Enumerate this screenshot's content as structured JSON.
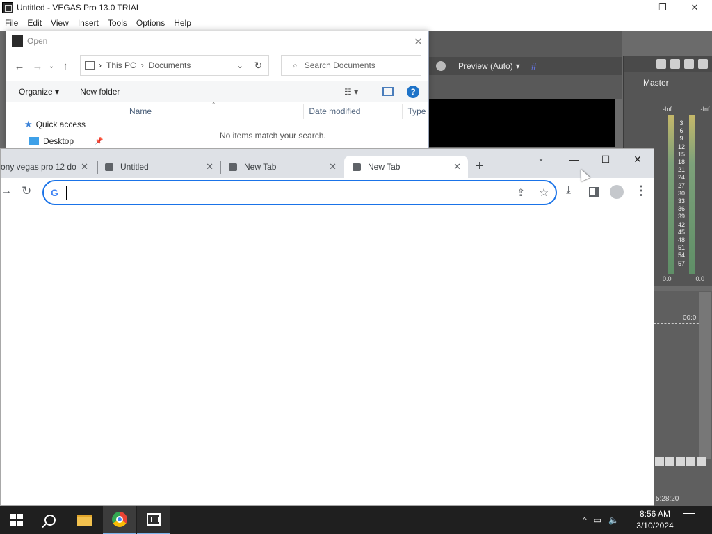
{
  "vegas": {
    "title": "Untitled - VEGAS Pro 13.0 TRIAL",
    "window_controls": {
      "minimize": "—",
      "maximize": "❐",
      "close": "✕"
    },
    "menu": [
      "File",
      "Edit",
      "View",
      "Insert",
      "Tools",
      "Options",
      "Help"
    ],
    "preview_mode": "Preview (Auto)",
    "master_label": "Master",
    "meter_inf_left": "-Inf.",
    "meter_inf_right": "-Inf.",
    "meter_scale": [
      "3",
      "6",
      "9",
      "12",
      "15",
      "18",
      "21",
      "24",
      "27",
      "30",
      "33",
      "36",
      "39",
      "42",
      "45",
      "48",
      "51",
      "54",
      "57"
    ],
    "meter_foot_left": "0.0",
    "meter_foot_right": "0.0",
    "timecode_partial": "00:0",
    "timeline_time": "5:28:20"
  },
  "open_dialog": {
    "title": "Open",
    "close": "✕",
    "breadcrumb": [
      "This PC",
      "Documents"
    ],
    "search_placeholder": "Search Documents",
    "organize_label": "Organize ▾",
    "new_folder_label": "New folder",
    "help_label": "?",
    "columns": [
      "Name",
      "Date modified",
      "Type"
    ],
    "tree": {
      "quick_access": "Quick access",
      "desktop": "Desktop"
    },
    "empty_message": "No items match your search."
  },
  "chrome": {
    "tabs": [
      {
        "title": "ony vegas pro 12 do"
      },
      {
        "title": "Untitled"
      },
      {
        "title": "New Tab"
      },
      {
        "title": "New Tab"
      }
    ],
    "omnibox_value": "",
    "window_controls": {
      "minimize": "—",
      "maximize": "☐",
      "close": "✕"
    }
  },
  "taskbar": {
    "time": "8:56 AM",
    "date": "3/10/2024"
  }
}
